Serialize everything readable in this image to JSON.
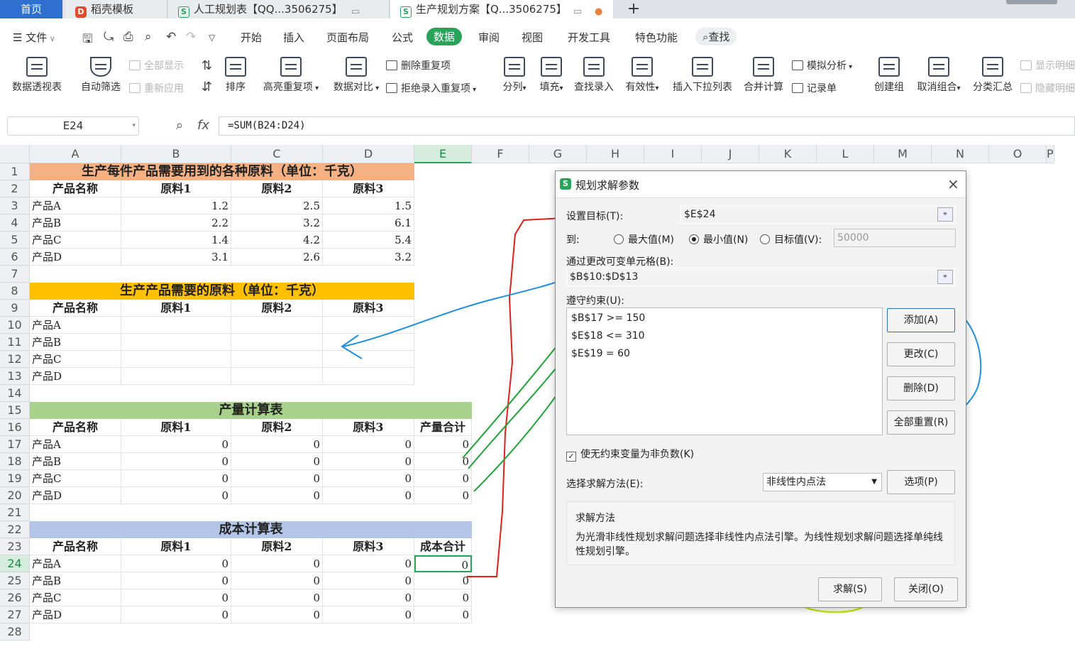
{
  "tabs": [
    {
      "label": "首页"
    },
    {
      "label": "稻壳模板"
    },
    {
      "label": "人工规划表【QQ...3506275】"
    },
    {
      "label": "生产规划方案【Q...3506275】"
    }
  ],
  "tab_new": "+",
  "menu": {
    "file": "文件",
    "items": [
      "开始",
      "插入",
      "页面布局",
      "公式",
      "数据",
      "审阅",
      "视图",
      "开发工具",
      "特色功能"
    ],
    "active": "数据",
    "search": "查找"
  },
  "ribbon": {
    "pivot": "数据透视表",
    "autofilter": "自动筛选",
    "show_all": "全部显示",
    "reapply": "重新应用",
    "sort": "排序",
    "highlight_dup": "高亮重复项",
    "compare": "数据对比",
    "remove_dup": "删除重复项",
    "reject_dup": "拒绝录入重复项",
    "split": "分列",
    "fill": "填充",
    "lookup": "查找录入",
    "validity": "有效性",
    "dropdown": "插入下拉列表",
    "merge_calc": "合并计算",
    "simulate": "模拟分析",
    "record": "记录单",
    "group": "创建组",
    "ungroup": "取消组合",
    "subtotal": "分类汇总",
    "show_detail": "显示明细",
    "hide_detail": "隐藏明细"
  },
  "formula_bar": {
    "cell": "E24",
    "fx": "fx",
    "formula": "=SUM(B24:D24)"
  },
  "columns": [
    "A",
    "B",
    "C",
    "D",
    "E",
    "F",
    "G",
    "H",
    "I",
    "J",
    "K",
    "L",
    "M",
    "N",
    "O",
    "P"
  ],
  "rows": [
    "1",
    "2",
    "3",
    "4",
    "5",
    "6",
    "7",
    "8",
    "9",
    "10",
    "11",
    "12",
    "13",
    "14",
    "15",
    "16",
    "17",
    "18",
    "19",
    "20",
    "21",
    "22",
    "23",
    "24",
    "25",
    "26",
    "27",
    "28"
  ],
  "sheet": {
    "t1": "生产每件产品需要用到的各种原料（单位：千克）",
    "t2": "生产产品需要的原料（单位：千克）",
    "t3": "产量计算表",
    "t4": "成本计算表",
    "hdr": [
      "产品名称",
      "原料1",
      "原料2",
      "原料3"
    ],
    "qty_total": "产量合计",
    "cost_total": "成本合计",
    "products": [
      "产品A",
      "产品B",
      "产品C",
      "产品D"
    ],
    "usage": [
      [
        "1.2",
        "2.5",
        "1.5"
      ],
      [
        "2.2",
        "3.2",
        "6.1"
      ],
      [
        "1.4",
        "4.2",
        "5.4"
      ],
      [
        "3.1",
        "2.6",
        "3.2"
      ]
    ],
    "zero": "0"
  },
  "dialog": {
    "title": "规划求解参数",
    "target_label": "设置目标(T):",
    "target_value": "$E$24",
    "to_label": "到:",
    "max": "最大值(M)",
    "min": "最小值(N)",
    "value_of": "目标值(V):",
    "value_input": "50000",
    "change_label": "通过更改可变单元格(B):",
    "change_value": "$B$10:$D$13",
    "constraints_label": "遵守约束(U):",
    "constraints": [
      "$B$17 >= 150",
      "$E$18 <= 310",
      "$E$19 = 60"
    ],
    "add": "添加(A)",
    "change": "更改(C)",
    "delete": "删除(D)",
    "reset": "全部重置(R)",
    "nonneg": "使无约束变量为非负数(K)",
    "method_label": "选择求解方法(E):",
    "method_value": "非线性内点法",
    "options": "选项(P)",
    "method_title": "求解方法",
    "method_desc": "为光滑非线性规划求解问题选择非线性内点法引擎。为线性规划求解问题选择单纯线性规划引擎。",
    "solve": "求解(S)",
    "close": "关闭(O)"
  },
  "colors": {
    "accent": "#2aa35a",
    "title1": "#f4b183",
    "title2": "#ffc000",
    "title3": "#a9d18e",
    "title4": "#b4c6e7",
    "annot_red": "#e0201b",
    "annot_blue": "#1f8fe0",
    "annot_green": "#22a33a",
    "annot_yellow": "#c6e81a"
  }
}
